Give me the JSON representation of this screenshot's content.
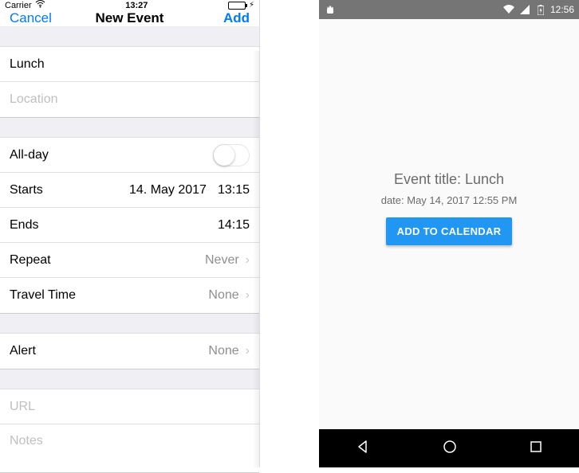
{
  "ios": {
    "status": {
      "carrier": "Carrier",
      "time": "13:27"
    },
    "nav": {
      "cancel": "Cancel",
      "title": "New Event",
      "add": "Add"
    },
    "fields": {
      "title_value": "Lunch",
      "location_placeholder": "Location",
      "allday_label": "All-day",
      "starts_label": "Starts",
      "starts_date": "14. May 2017",
      "starts_time": "13:15",
      "ends_label": "Ends",
      "ends_time": "14:15",
      "repeat_label": "Repeat",
      "repeat_value": "Never",
      "travel_label": "Travel Time",
      "travel_value": "None",
      "alert_label": "Alert",
      "alert_value": "None",
      "url_placeholder": "URL",
      "notes_placeholder": "Notes"
    }
  },
  "android": {
    "status": {
      "time": "12:56"
    },
    "title": "Event title: Lunch",
    "date": "date: May 14, 2017 12:55 PM",
    "button": "ADD TO CALENDAR"
  }
}
